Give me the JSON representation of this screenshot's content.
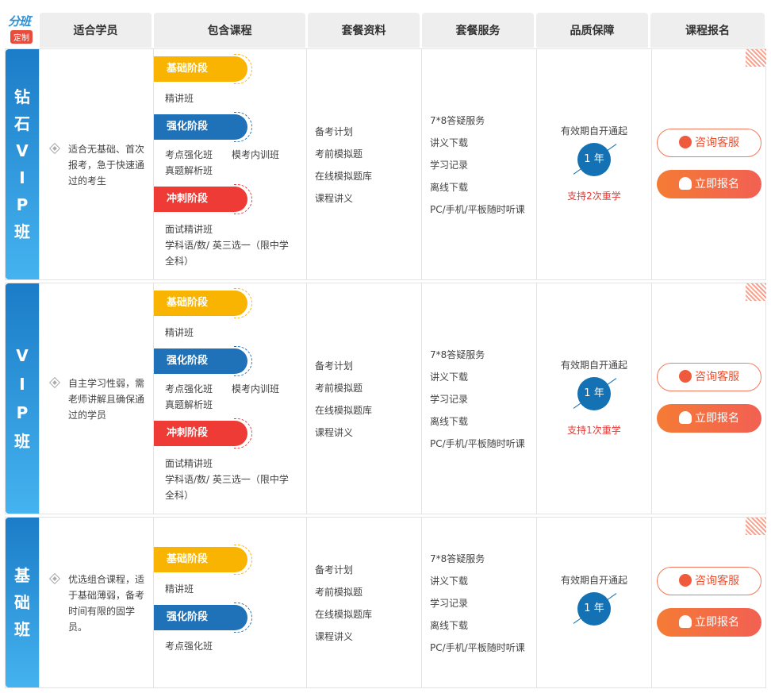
{
  "logo": {
    "line1": "分班",
    "line2": "定制"
  },
  "headers": [
    "适合学员",
    "包含课程",
    "套餐资料",
    "套餐服务",
    "品质保障",
    "课程报名"
  ],
  "rows": [
    {
      "tag": [
        "钻",
        "石",
        "V",
        "I",
        "P",
        "班"
      ],
      "students": "适合无基础、首次报考，急于快速通过的考生",
      "stages": [
        {
          "label": "基础阶段",
          "lines": [
            "精讲班"
          ]
        },
        {
          "label": "强化阶段",
          "lines": [
            "考点强化班　　模考内训班",
            "真题解析班"
          ]
        },
        {
          "label": "冲刺阶段",
          "lines": [
            "面试精讲班",
            "学科语/数/ 英三选一（限中学",
            "全科）"
          ]
        }
      ],
      "materials": [
        "备考计划",
        "考前模拟题",
        "在线模拟题库",
        "课程讲义"
      ],
      "services": [
        "7*8答疑服务",
        "讲义下载",
        "学习记录",
        "离线下载",
        "PC/手机/平板随时听课"
      ],
      "validity": "有效期自开通起",
      "duration": "1 年",
      "retake": "支持2次重学",
      "consult": "咨询客服",
      "enroll": "立即报名"
    },
    {
      "tag": [
        "V",
        "I",
        "P",
        "班"
      ],
      "students": "自主学习性弱，需老师讲解且确保通过的学员",
      "stages": [
        {
          "label": "基础阶段",
          "lines": [
            "精讲班"
          ]
        },
        {
          "label": "强化阶段",
          "lines": [
            "考点强化班　　模考内训班",
            "真题解析班"
          ]
        },
        {
          "label": "冲刺阶段",
          "lines": [
            "面试精讲班",
            "学科语/数/ 英三选一（限中学",
            "全科）"
          ]
        }
      ],
      "materials": [
        "备考计划",
        "考前模拟题",
        "在线模拟题库",
        "课程讲义"
      ],
      "services": [
        "7*8答疑服务",
        "讲义下载",
        "学习记录",
        "离线下载",
        "PC/手机/平板随时听课"
      ],
      "validity": "有效期自开通起",
      "duration": "1 年",
      "retake": "支持1次重学",
      "consult": "咨询客服",
      "enroll": "立即报名"
    },
    {
      "tag": [
        "基",
        "础",
        "班"
      ],
      "students": "优选组合课程，适于基础薄弱，备考时间有限的固学员。",
      "stages": [
        {
          "label": "基础阶段",
          "lines": [
            "精讲班"
          ]
        },
        {
          "label": "强化阶段",
          "lines": [
            "考点强化班"
          ]
        }
      ],
      "materials": [
        "备考计划",
        "考前模拟题",
        "在线模拟题库",
        "课程讲义"
      ],
      "services": [
        "7*8答疑服务",
        "讲义下载",
        "学习记录",
        "离线下载",
        "PC/手机/平板随时听课"
      ],
      "validity": "有效期自开通起",
      "duration": "1 年",
      "retake": "",
      "consult": "咨询客服",
      "enroll": "立即报名"
    }
  ]
}
